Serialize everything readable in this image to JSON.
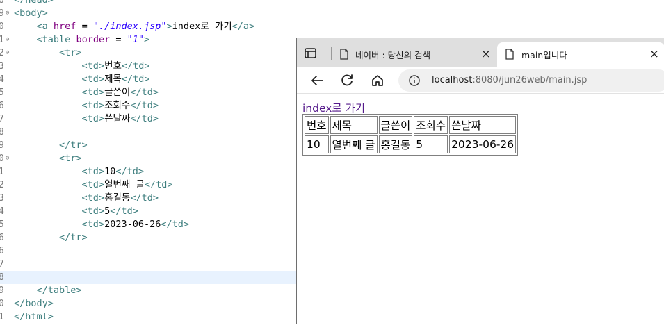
{
  "editor": {
    "lines": [
      {
        "num": "8",
        "fold": "",
        "html": "<span class='tag'>&lt;/head&gt;</span>"
      },
      {
        "num": "9",
        "fold": "⊖",
        "html": "<span class='tag'>&lt;body&gt;</span>"
      },
      {
        "num": "0",
        "fold": "",
        "html": "    <span class='tag'>&lt;a</span> <span class='attr'>href</span> = <span class='val'>\"./index.jsp\"</span><span class='tag'>&gt;</span>index로 가기<span class='tag'>&lt;/a&gt;</span>"
      },
      {
        "num": "1",
        "fold": "⊖",
        "html": "    <span class='tag'>&lt;table</span> <span class='attr'>border</span> = <span class='val'>\"1\"</span><span class='tag'>&gt;</span>"
      },
      {
        "num": "2",
        "fold": "⊖",
        "html": "        <span class='tag'>&lt;tr&gt;</span>"
      },
      {
        "num": "3",
        "fold": "",
        "html": "            <span class='tag'>&lt;td&gt;</span>번호<span class='tag'>&lt;/td&gt;</span>"
      },
      {
        "num": "4",
        "fold": "",
        "html": "            <span class='tag'>&lt;td&gt;</span>제목<span class='tag'>&lt;/td&gt;</span>"
      },
      {
        "num": "5",
        "fold": "",
        "html": "            <span class='tag'>&lt;td&gt;</span>글쓴이<span class='tag'>&lt;/td&gt;</span>"
      },
      {
        "num": "6",
        "fold": "",
        "html": "            <span class='tag'>&lt;td&gt;</span>조회수<span class='tag'>&lt;/td&gt;</span>"
      },
      {
        "num": "7",
        "fold": "",
        "html": "            <span class='tag'>&lt;td&gt;</span>쓴날짜<span class='tag'>&lt;/td&gt;</span>"
      },
      {
        "num": "8",
        "fold": "",
        "html": ""
      },
      {
        "num": "9",
        "fold": "",
        "html": "        <span class='tag'>&lt;/tr&gt;</span>"
      },
      {
        "num": "0",
        "fold": "⊖",
        "html": "        <span class='tag'>&lt;tr&gt;</span>"
      },
      {
        "num": "1",
        "fold": "",
        "html": "            <span class='tag'>&lt;td&gt;</span>10<span class='tag'>&lt;/td&gt;</span>"
      },
      {
        "num": "2",
        "fold": "",
        "html": "            <span class='tag'>&lt;td&gt;</span>열번째 글<span class='tag'>&lt;/td&gt;</span>"
      },
      {
        "num": "3",
        "fold": "",
        "html": "            <span class='tag'>&lt;td&gt;</span>홍길동<span class='tag'>&lt;/td&gt;</span>"
      },
      {
        "num": "4",
        "fold": "",
        "html": "            <span class='tag'>&lt;td&gt;</span>5<span class='tag'>&lt;/td&gt;</span>"
      },
      {
        "num": "5",
        "fold": "",
        "html": "            <span class='tag'>&lt;td&gt;</span>2023-06-26<span class='tag'>&lt;/td&gt;</span>"
      },
      {
        "num": "6",
        "fold": "",
        "html": "        <span class='tag'>&lt;/tr&gt;</span>"
      },
      {
        "num": "6",
        "fold": "",
        "html": ""
      },
      {
        "num": "7",
        "fold": "",
        "html": ""
      },
      {
        "num": "8",
        "fold": "",
        "html": "",
        "current": true
      },
      {
        "num": "9",
        "fold": "",
        "html": "    <span class='tag'>&lt;/table&gt;</span>"
      },
      {
        "num": "0",
        "fold": "",
        "html": "<span class='tag'>&lt;/body&gt;</span>"
      },
      {
        "num": "1",
        "fold": "",
        "html": "<span class='tag'>&lt;/html&gt;</span>"
      }
    ]
  },
  "browser": {
    "tabs": [
      {
        "title": "네이버 : 당신의 검색",
        "close": "×",
        "active": false
      },
      {
        "title": "main입니다",
        "close": "×",
        "active": true
      }
    ],
    "url_host": "localhost",
    "url_rest": ":8080/jun26web/main.jsp",
    "icons": {
      "back": "arrow-left-icon",
      "reload": "reload-icon",
      "home": "home-icon",
      "info": "info-icon",
      "page": "page-icon",
      "tab_actions": "tab-actions-icon"
    },
    "page": {
      "link_text": "index로 가기",
      "table": {
        "header": [
          "번호",
          "제목",
          "글쓴이",
          "조회수",
          "쓴날짜"
        ],
        "row": [
          "10",
          "열번째 글",
          "홍길동",
          "5",
          "2023-06-26"
        ]
      }
    }
  }
}
